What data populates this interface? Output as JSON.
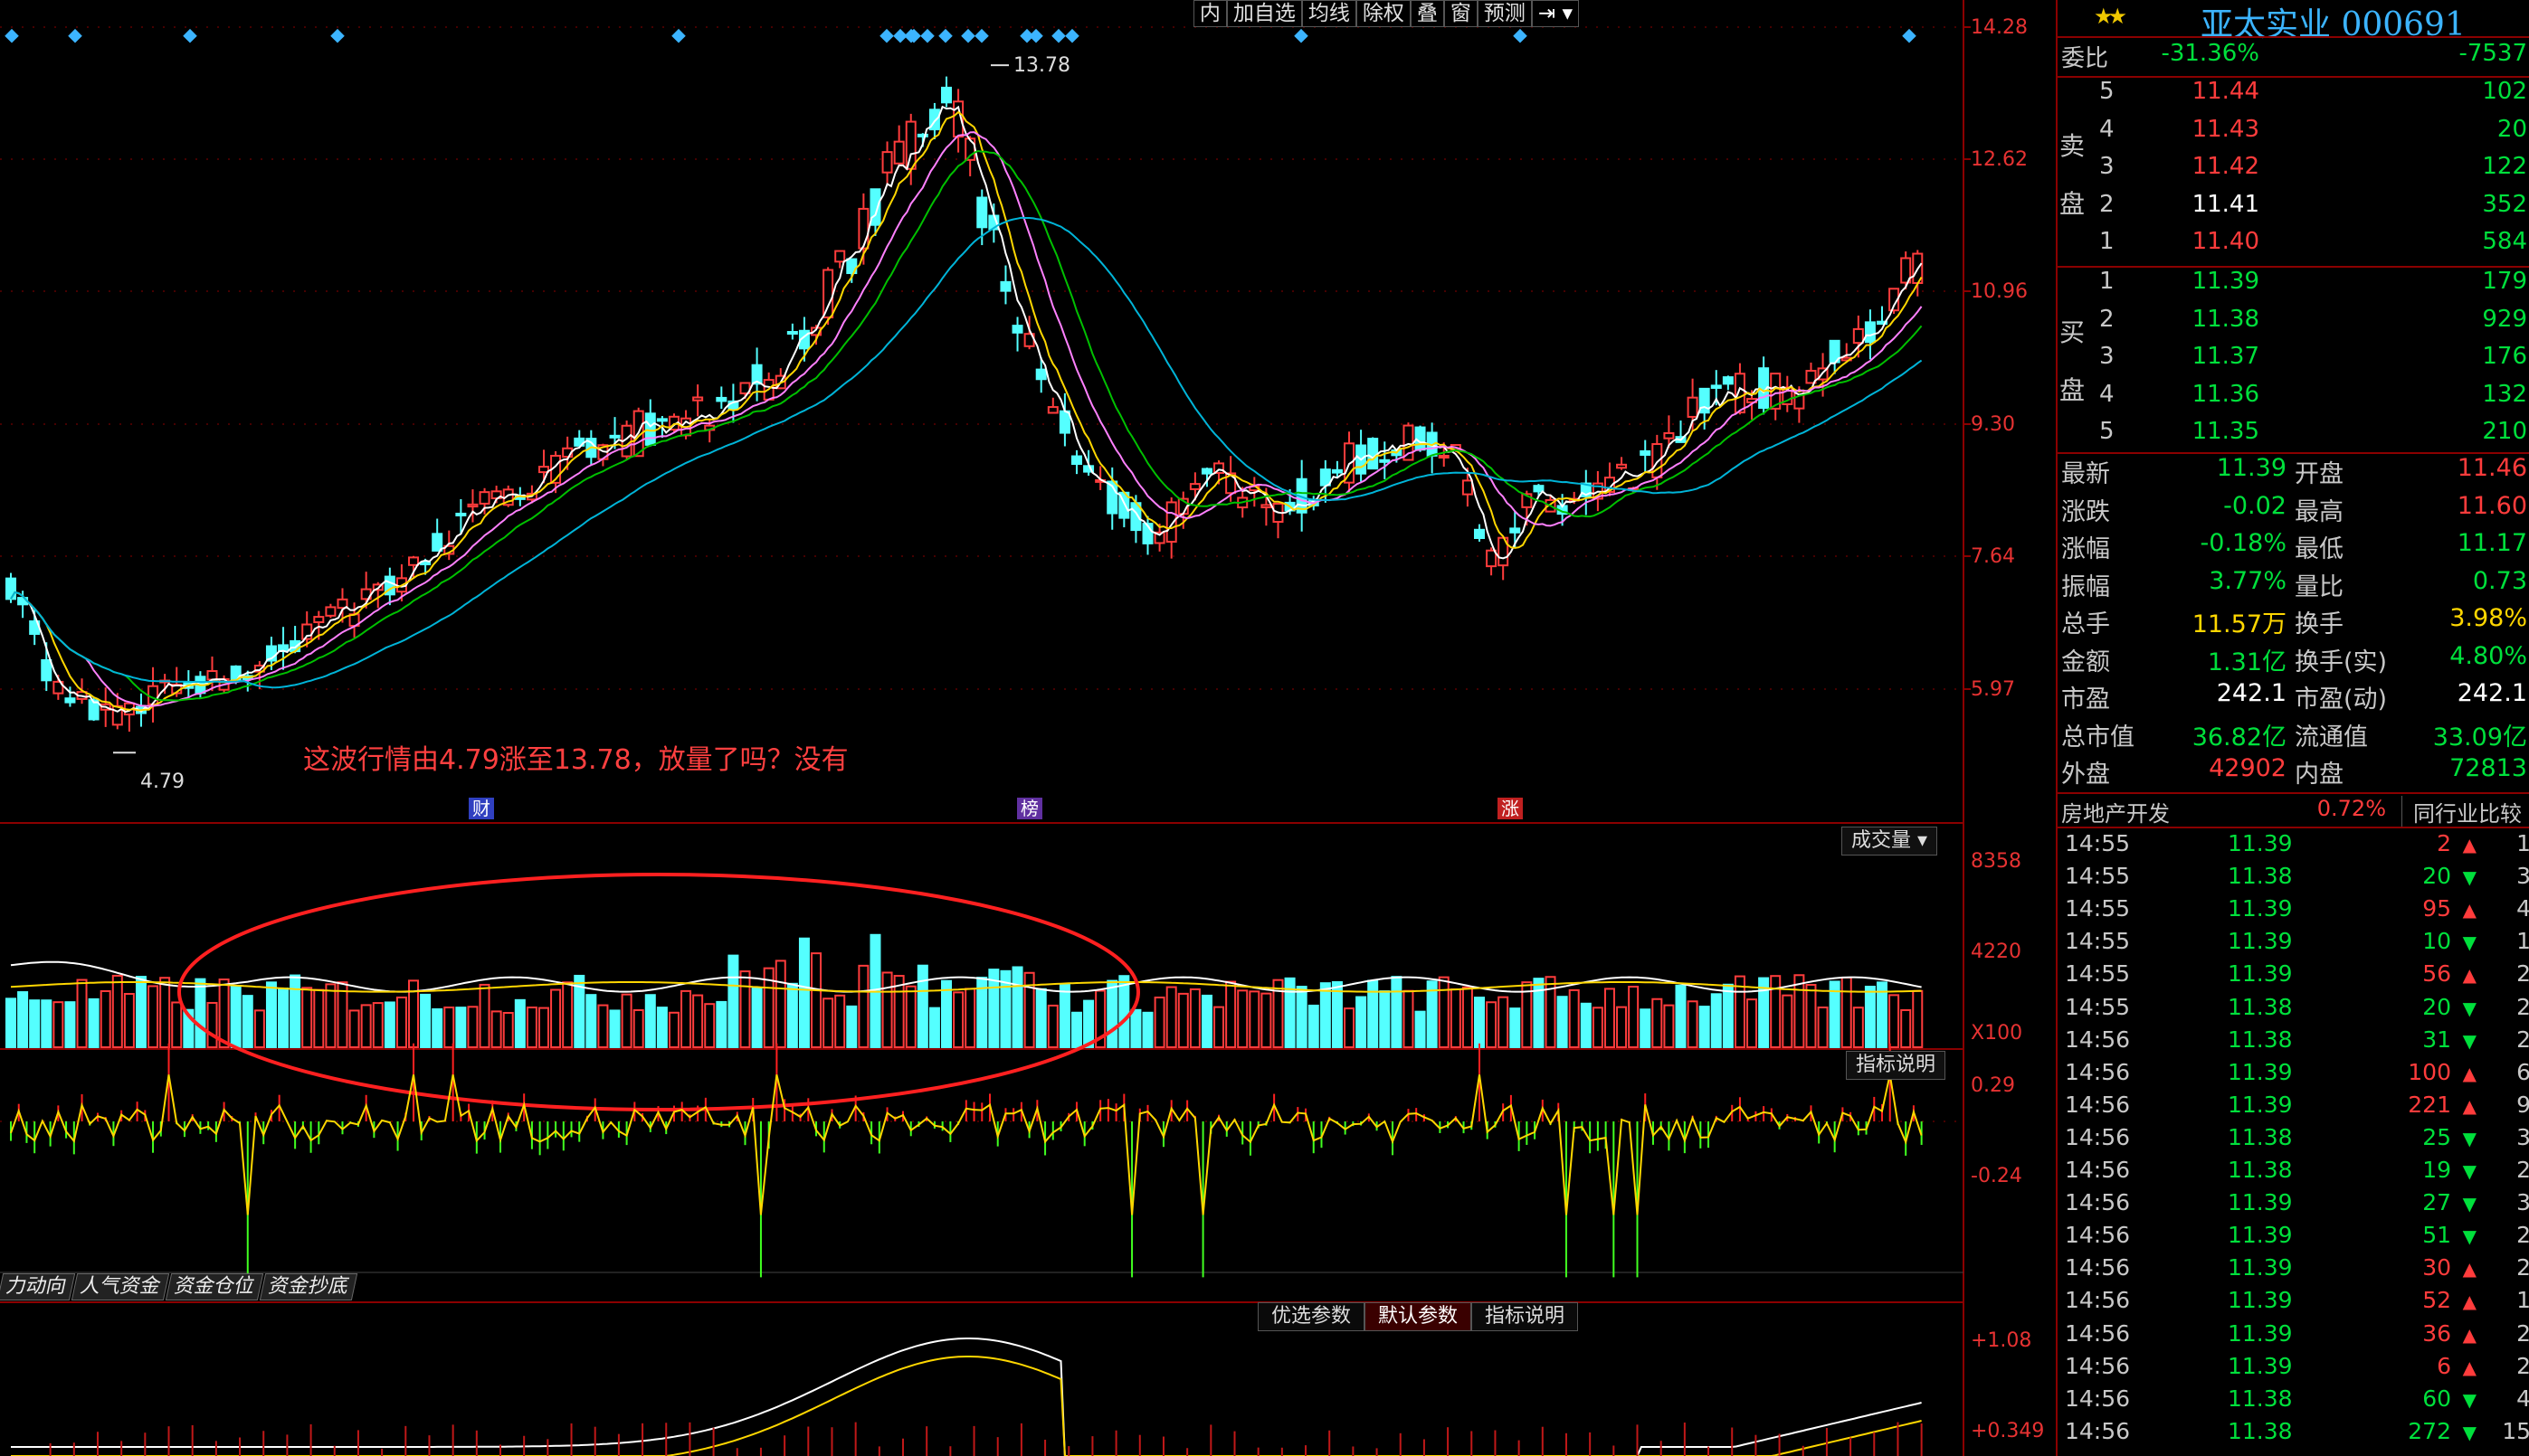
{
  "toolbar": [
    "内",
    "加自选",
    "均线",
    "除权",
    "叠",
    "窗",
    "预测"
  ],
  "price_axis": [
    "14.28",
    "12.62",
    "10.96",
    "9.30",
    "7.64",
    "5.97"
  ],
  "volume_axis": [
    "8358",
    "4220",
    "X100"
  ],
  "indicator_axis": [
    "0.29",
    "-0.24"
  ],
  "bottom_axis": [
    "+1.08",
    "+0.349"
  ],
  "chart_high_label": "13.78",
  "chart_low_label": "4.79",
  "annotation": "这波行情由4.79涨至13.78，放量了吗？没有",
  "event_markers": [
    {
      "text": "财",
      "color": "#3040c0"
    },
    {
      "text": "榜",
      "color": "#6030a0"
    },
    {
      "text": "涨",
      "color": "#c02020"
    }
  ],
  "volume_tab": "成交量",
  "indicator_tab": "指标说明",
  "bottom_tabs": [
    "力动向",
    "人气资金",
    "资金仓位",
    "资金抄底"
  ],
  "param_tabs": [
    "优选参数",
    "默认参数",
    "指标说明"
  ],
  "stock": {
    "name": "亚太实业",
    "code": "000691",
    "title": "亚太实业 000691"
  },
  "weibi": {
    "label": "委比",
    "pct": "-31.36%",
    "val": "-7537"
  },
  "sell_label": "卖盘",
  "buy_label": "买盘",
  "sell": [
    {
      "lvl": "5",
      "price": "11.44",
      "vol": "102"
    },
    {
      "lvl": "4",
      "price": "11.43",
      "vol": "20"
    },
    {
      "lvl": "3",
      "price": "11.42",
      "vol": "122"
    },
    {
      "lvl": "2",
      "price": "11.41",
      "vol": "352"
    },
    {
      "lvl": "1",
      "price": "11.40",
      "vol": "584"
    }
  ],
  "buy": [
    {
      "lvl": "1",
      "price": "11.39",
      "vol": "179"
    },
    {
      "lvl": "2",
      "price": "11.38",
      "vol": "929"
    },
    {
      "lvl": "3",
      "price": "11.37",
      "vol": "176"
    },
    {
      "lvl": "4",
      "price": "11.36",
      "vol": "132"
    },
    {
      "lvl": "5",
      "price": "11.35",
      "vol": "210"
    }
  ],
  "stats": [
    {
      "l1": "最新",
      "v1": "11.39",
      "c1": "green",
      "l2": "开盘",
      "v2": "11.46",
      "c2": "red"
    },
    {
      "l1": "涨跌",
      "v1": "-0.02",
      "c1": "green",
      "l2": "最高",
      "v2": "11.60",
      "c2": "red"
    },
    {
      "l1": "涨幅",
      "v1": "-0.18%",
      "c1": "green",
      "l2": "最低",
      "v2": "11.17",
      "c2": "green"
    },
    {
      "l1": "振幅",
      "v1": "3.77%",
      "c1": "green",
      "l2": "量比",
      "v2": "0.73",
      "c2": "green"
    },
    {
      "l1": "总手",
      "v1": "11.57万",
      "c1": "yellow",
      "l2": "换手",
      "v2": "3.98%",
      "c2": "yellow"
    },
    {
      "l1": "金额",
      "v1": "1.31亿",
      "c1": "green",
      "l2": "换手(实)",
      "v2": "4.80%",
      "c2": "green"
    },
    {
      "l1": "市盈",
      "v1": "242.1",
      "c1": "white",
      "l2": "市盈(动)",
      "v2": "242.1",
      "c2": "white"
    },
    {
      "l1": "总市值",
      "v1": "36.82亿",
      "c1": "green",
      "l2": "流通值",
      "v2": "33.09亿",
      "c2": "green"
    },
    {
      "l1": "外盘",
      "v1": "42902",
      "c1": "red",
      "l2": "内盘",
      "v2": "72813",
      "c2": "green"
    }
  ],
  "sector": {
    "name": "房地产开发",
    "pct": "0.72%",
    "btn": "同行业比较"
  },
  "ticks": [
    {
      "t": "14:55",
      "p": "11.39",
      "v": "2",
      "d": "up",
      "n": "1"
    },
    {
      "t": "14:55",
      "p": "11.38",
      "v": "20",
      "d": "down",
      "n": "3"
    },
    {
      "t": "14:55",
      "p": "11.39",
      "v": "95",
      "d": "up",
      "n": "4"
    },
    {
      "t": "14:55",
      "p": "11.39",
      "v": "10",
      "d": "down",
      "n": "1"
    },
    {
      "t": "14:55",
      "p": "11.39",
      "v": "56",
      "d": "up",
      "n": "2"
    },
    {
      "t": "14:55",
      "p": "11.38",
      "v": "20",
      "d": "down",
      "n": "2"
    },
    {
      "t": "14:56",
      "p": "11.38",
      "v": "31",
      "d": "down",
      "n": "2"
    },
    {
      "t": "14:56",
      "p": "11.39",
      "v": "100",
      "d": "up",
      "n": "6"
    },
    {
      "t": "14:56",
      "p": "11.39",
      "v": "221",
      "d": "up",
      "n": "9"
    },
    {
      "t": "14:56",
      "p": "11.38",
      "v": "25",
      "d": "down",
      "n": "3"
    },
    {
      "t": "14:56",
      "p": "11.38",
      "v": "19",
      "d": "down",
      "n": "2"
    },
    {
      "t": "14:56",
      "p": "11.39",
      "v": "27",
      "d": "down",
      "n": "3"
    },
    {
      "t": "14:56",
      "p": "11.39",
      "v": "51",
      "d": "down",
      "n": "2"
    },
    {
      "t": "14:56",
      "p": "11.39",
      "v": "30",
      "d": "up",
      "n": "2"
    },
    {
      "t": "14:56",
      "p": "11.39",
      "v": "52",
      "d": "up",
      "n": "1"
    },
    {
      "t": "14:56",
      "p": "11.39",
      "v": "36",
      "d": "up",
      "n": "2"
    },
    {
      "t": "14:56",
      "p": "11.39",
      "v": "6",
      "d": "up",
      "n": "2"
    },
    {
      "t": "14:56",
      "p": "11.38",
      "v": "60",
      "d": "down",
      "n": "4"
    },
    {
      "t": "14:56",
      "p": "11.38",
      "v": "272",
      "d": "down",
      "n": "15"
    }
  ],
  "colors": {
    "up": "#ff3c3c",
    "down": "#54ffff",
    "ma5": "#ffffff",
    "ma10": "#ffd700",
    "ma20": "#ff80ff",
    "ma30": "#00c000",
    "ma60": "#00b4d8",
    "border": "#8b0000",
    "ellipse": "#ff2020"
  },
  "chart_data": {
    "type": "candlestick",
    "ylim": [
      4.2,
      14.28
    ],
    "yticks": [
      14.28,
      12.62,
      10.96,
      9.3,
      7.64,
      5.97
    ],
    "high": 13.78,
    "low": 4.79,
    "price_keypoints": [
      [
        0,
        7.0
      ],
      [
        10,
        5.6
      ],
      [
        25,
        5.25
      ],
      [
        40,
        5.6
      ],
      [
        55,
        5.7
      ],
      [
        75,
        6.3
      ],
      [
        100,
        7.1
      ],
      [
        120,
        8.0
      ],
      [
        150,
        8.9
      ],
      [
        170,
        9.1
      ],
      [
        190,
        9.6
      ],
      [
        205,
        10.6
      ],
      [
        215,
        11.6
      ],
      [
        228,
        12.9
      ],
      [
        238,
        13.3
      ],
      [
        250,
        11.3
      ],
      [
        262,
        9.6
      ],
      [
        275,
        8.2
      ],
      [
        290,
        7.6
      ],
      [
        305,
        8.4
      ],
      [
        320,
        7.9
      ],
      [
        340,
        8.6
      ],
      [
        355,
        8.9
      ],
      [
        365,
        8.8
      ],
      [
        375,
        7.2
      ],
      [
        385,
        8.0
      ],
      [
        400,
        8.2
      ],
      [
        415,
        8.5
      ],
      [
        425,
        9.2
      ],
      [
        440,
        9.5
      ],
      [
        455,
        9.6
      ],
      [
        470,
        10.3
      ],
      [
        484,
        11.4
      ]
    ],
    "vol_ylim": [
      0,
      8358
    ],
    "ind_ylim": [
      -0.24,
      0.29
    ]
  }
}
